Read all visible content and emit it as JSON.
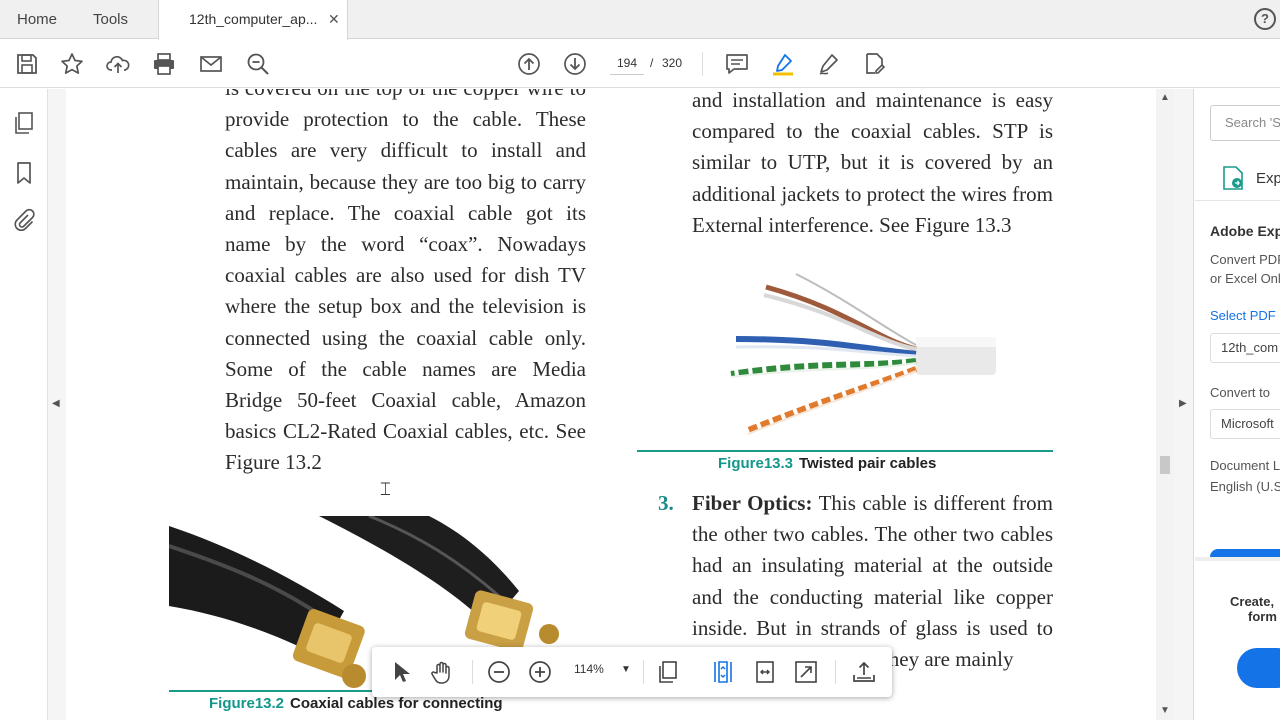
{
  "tabs": {
    "home": "Home",
    "tools": "Tools",
    "document": "12th_computer_ap...",
    "close": "✕",
    "help": "?"
  },
  "toolbar": {
    "current_page": "194",
    "separator": "/",
    "total_pages": "320"
  },
  "document": {
    "left_text": "is covered on the top of the copper wire to provide protection to the cable. These cables are very difficult to install and maintain, because they are too big to carry and replace. The coaxial cable got its name by the word “coax”. Nowadays coaxial cables are also used for dish TV where the setup box and the television is connected using the coaxial cable only. Some of the cable names are Media Bridge 50-feet Coaxial cable, Amazon basics CL2-Rated Coaxial cables, etc. See Figure 13.2",
    "right_text": "and installation and maintenance is easy compared to the coaxial cables. STP is similar to UTP, but it is covered by an additional jackets to protect the wires from External interference. See Figure 13.3",
    "figure3_label": "Figure13.3",
    "figure3_caption": "Twisted pair cables",
    "item3_number": "3.",
    "item3_title": "Fiber Optics:",
    "item3_text": " This cable is different from the other two cables. The other two cables had an insulating material at the outside and the conducting material like copper inside. But in strands of glass is used to send the information. They are mainly",
    "figure2_label": "Figure13.2",
    "figure2_caption": "Coaxial cables for connecting"
  },
  "right_panel": {
    "search_placeholder": "Search 'S",
    "export_label": "Exp",
    "heading": "Adobe Exp",
    "desc_line1": "Convert PDF",
    "desc_line2": "or Excel Onl",
    "select_label": "Select PDF F",
    "file_value": "12th_com",
    "convert_label": "Convert to",
    "convert_value": "Microsoft",
    "doc_lang_label": "Document L",
    "doc_lang_value": "English (U.S",
    "create_line1": "Create,",
    "create_line2": "form"
  },
  "floating_toolbar": {
    "zoom": "114%"
  },
  "colors": {
    "accent": "#1473e6",
    "caption_teal": "#12978a",
    "highlighter": "#f2c200"
  }
}
